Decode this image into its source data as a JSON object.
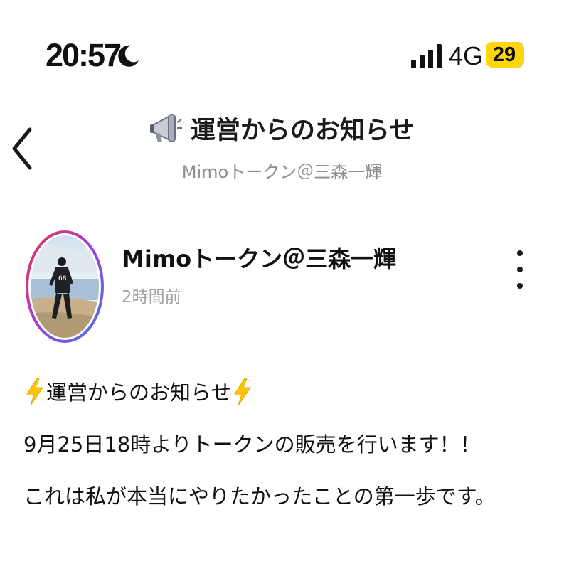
{
  "status_bar": {
    "time": "20:57",
    "moon_icon": "moon-icon",
    "signal_icon": "cellular-signal-icon",
    "network": "4G",
    "battery": "29",
    "battery_color": "#ffd60a"
  },
  "header": {
    "back_icon": "chevron-left-icon",
    "title_icon": "megaphone-icon",
    "title": "運営からのお知らせ",
    "subtitle": "Mimoトークン＠三森一輝"
  },
  "post": {
    "avatar_icon": "avatar",
    "author": "Mimoトークン＠三森一輝",
    "time": "2時間前",
    "more_icon": "more-vertical-icon",
    "body": {
      "line1_text": "運営からのお知らせ",
      "line1_icon": "lightning-icon",
      "line2": "9月25日18時よりトークンの販売を行います！！",
      "line3": "これは私が本当にやりたかったことの第一歩です。"
    }
  },
  "colors": {
    "ring_gradient": [
      "#e8334a",
      "#a23fd6",
      "#3d7be6"
    ],
    "lightning": "#ffc400",
    "muted_text": "#8e8e93"
  }
}
